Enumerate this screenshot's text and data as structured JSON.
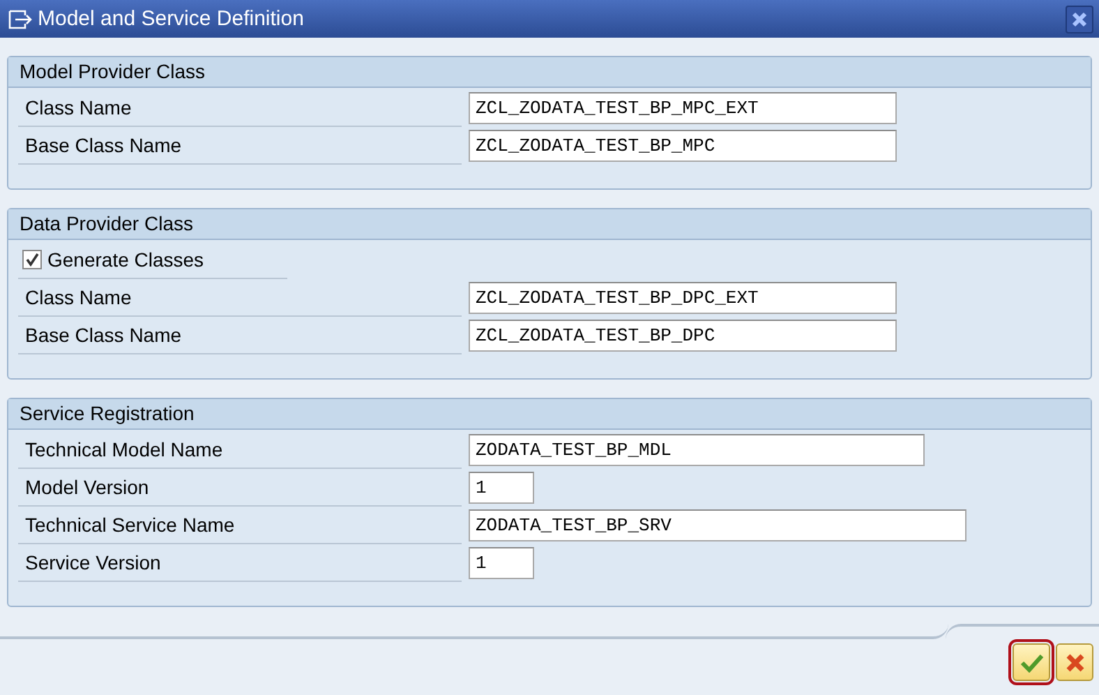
{
  "window": {
    "title": "Model and Service Definition"
  },
  "sections": [
    {
      "title": "Model Provider Class",
      "rows": [
        {
          "kind": "field",
          "label": "Class Name",
          "value": "ZCL_ZODATA_TEST_BP_MPC_EXT"
        },
        {
          "kind": "field",
          "label": "Base Class Name",
          "value": "ZCL_ZODATA_TEST_BP_MPC"
        }
      ]
    },
    {
      "title": "Data Provider Class",
      "rows": [
        {
          "kind": "checkbox",
          "label": "Generate Classes",
          "checked": true
        },
        {
          "kind": "field",
          "label": "Class Name",
          "value": "ZCL_ZODATA_TEST_BP_DPC_EXT"
        },
        {
          "kind": "field",
          "label": "Base Class Name",
          "value": "ZCL_ZODATA_TEST_BP_DPC"
        }
      ]
    },
    {
      "title": "Service Registration",
      "rows": [
        {
          "kind": "field",
          "label": "Technical Model Name",
          "value": "ZODATA_TEST_BP_MDL"
        },
        {
          "kind": "field",
          "label": "Model Version",
          "value": "1"
        },
        {
          "kind": "field",
          "label": "Technical Service Name",
          "value": "ZODATA_TEST_BP_SRV"
        },
        {
          "kind": "field",
          "label": "Service Version",
          "value": "1"
        }
      ]
    }
  ]
}
